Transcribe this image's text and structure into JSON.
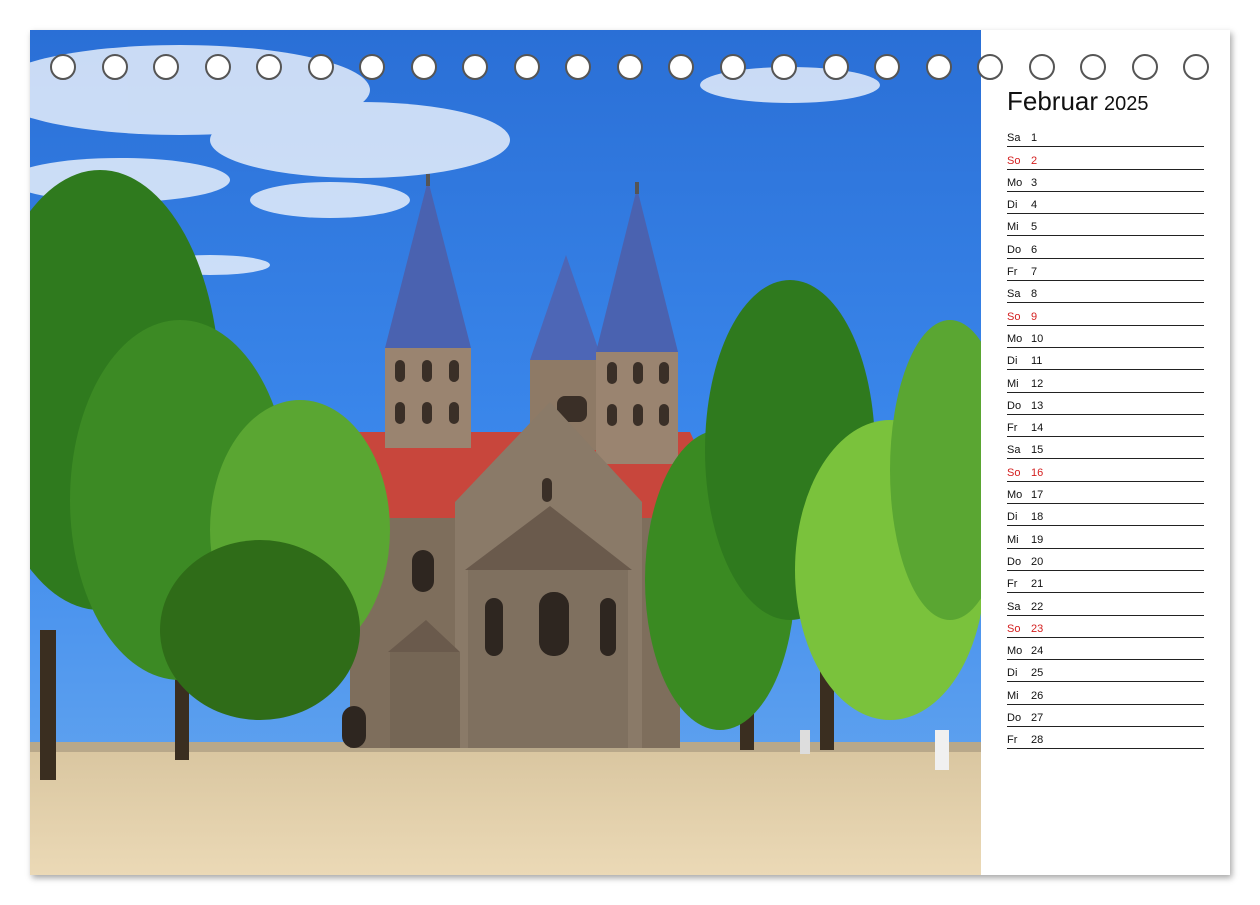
{
  "photo": {
    "description_icon": "church-photo",
    "colors": {
      "sky": "#3a86ea",
      "roof": "#c8463c",
      "spire": "#4a62b0",
      "stone": "#8a7a68",
      "tree": "#4f9a2c",
      "ground": "#e3cfa8"
    }
  },
  "binding": {
    "hole_count": 23
  },
  "calendar": {
    "month": "Februar",
    "year": "2025",
    "sunday_color": "#d42020",
    "days": [
      {
        "wd": "Sa",
        "d": "1",
        "sun": false
      },
      {
        "wd": "So",
        "d": "2",
        "sun": true
      },
      {
        "wd": "Mo",
        "d": "3",
        "sun": false
      },
      {
        "wd": "Di",
        "d": "4",
        "sun": false
      },
      {
        "wd": "Mi",
        "d": "5",
        "sun": false
      },
      {
        "wd": "Do",
        "d": "6",
        "sun": false
      },
      {
        "wd": "Fr",
        "d": "7",
        "sun": false
      },
      {
        "wd": "Sa",
        "d": "8",
        "sun": false
      },
      {
        "wd": "So",
        "d": "9",
        "sun": true
      },
      {
        "wd": "Mo",
        "d": "10",
        "sun": false
      },
      {
        "wd": "Di",
        "d": "11",
        "sun": false
      },
      {
        "wd": "Mi",
        "d": "12",
        "sun": false
      },
      {
        "wd": "Do",
        "d": "13",
        "sun": false
      },
      {
        "wd": "Fr",
        "d": "14",
        "sun": false
      },
      {
        "wd": "Sa",
        "d": "15",
        "sun": false
      },
      {
        "wd": "So",
        "d": "16",
        "sun": true
      },
      {
        "wd": "Mo",
        "d": "17",
        "sun": false
      },
      {
        "wd": "Di",
        "d": "18",
        "sun": false
      },
      {
        "wd": "Mi",
        "d": "19",
        "sun": false
      },
      {
        "wd": "Do",
        "d": "20",
        "sun": false
      },
      {
        "wd": "Fr",
        "d": "21",
        "sun": false
      },
      {
        "wd": "Sa",
        "d": "22",
        "sun": false
      },
      {
        "wd": "So",
        "d": "23",
        "sun": true
      },
      {
        "wd": "Mo",
        "d": "24",
        "sun": false
      },
      {
        "wd": "Di",
        "d": "25",
        "sun": false
      },
      {
        "wd": "Mi",
        "d": "26",
        "sun": false
      },
      {
        "wd": "Do",
        "d": "27",
        "sun": false
      },
      {
        "wd": "Fr",
        "d": "28",
        "sun": false
      }
    ]
  }
}
